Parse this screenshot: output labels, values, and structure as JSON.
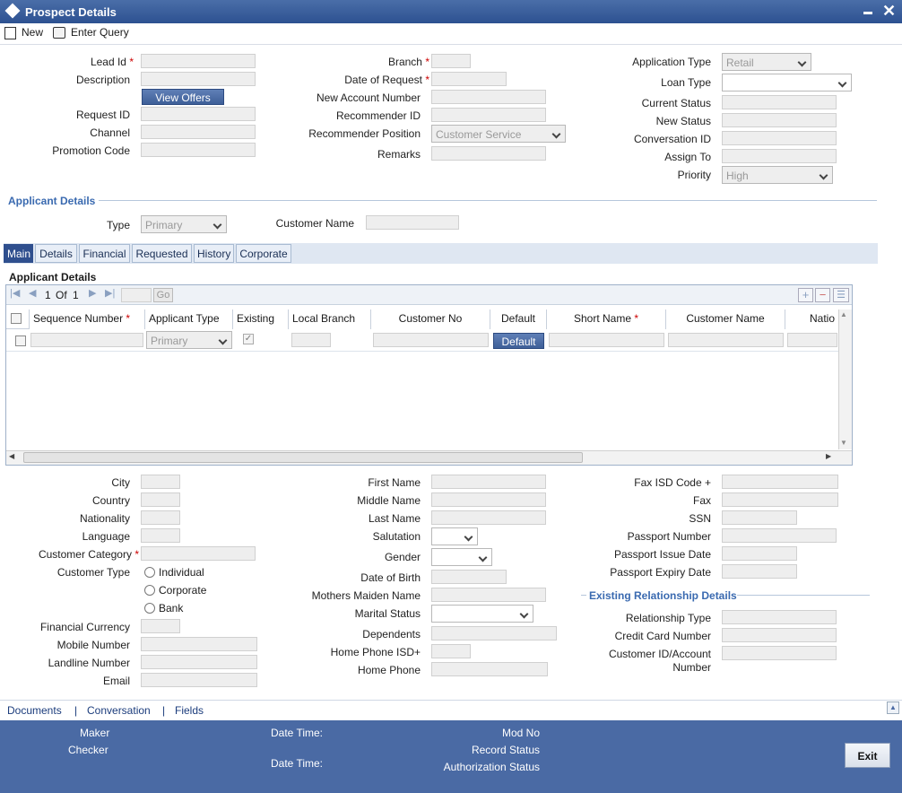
{
  "window": {
    "title": "Prospect Details"
  },
  "toolbar": {
    "new_label": "New",
    "enter_query_label": "Enter Query"
  },
  "header_fields": {
    "lead_id": "Lead Id",
    "description": "Description",
    "view_offers": "View Offers",
    "request_id": "Request ID",
    "channel": "Channel",
    "promotion_code": "Promotion Code",
    "branch": "Branch",
    "date_of_request": "Date of Request",
    "new_account_number": "New Account Number",
    "recommender_id": "Recommender ID",
    "recommender_position": "Recommender Position",
    "recommender_position_value": "Customer Service",
    "remarks": "Remarks",
    "application_type": "Application Type",
    "application_type_value": "Retail",
    "loan_type": "Loan Type",
    "current_status": "Current Status",
    "new_status": "New Status",
    "conversation_id": "Conversation ID",
    "assign_to": "Assign To",
    "priority": "Priority",
    "priority_value": "High"
  },
  "applicant": {
    "section_title": "Applicant Details",
    "type_label": "Type",
    "type_value": "Primary",
    "customer_name_label": "Customer Name"
  },
  "tabs": [
    {
      "label": "Main"
    },
    {
      "label": "Details"
    },
    {
      "label": "Financial"
    },
    {
      "label": "Requested"
    },
    {
      "label": "History"
    },
    {
      "label": "Corporate"
    }
  ],
  "grid": {
    "title": "Applicant Details",
    "page_current": "1",
    "page_of": "Of",
    "page_total": "1",
    "go_label": "Go",
    "columns": [
      "Sequence Number",
      "Applicant Type",
      "Existing",
      "Local Branch",
      "Customer No",
      "Default",
      "Short Name",
      "Customer Name",
      "Natio"
    ],
    "row": {
      "applicant_type": "Primary",
      "default_button": "Default"
    }
  },
  "lower_left": {
    "city": "City",
    "country": "Country",
    "nationality": "Nationality",
    "language": "Language",
    "customer_category": "Customer Category",
    "customer_type": "Customer Type",
    "individual": "Individual",
    "corporate": "Corporate",
    "bank": "Bank",
    "financial_currency": "Financial Currency",
    "mobile_number": "Mobile Number",
    "landline_number": "Landline Number",
    "email": "Email"
  },
  "lower_middle": {
    "first_name": "First Name",
    "middle_name": "Middle Name",
    "last_name": "Last Name",
    "salutation": "Salutation",
    "gender": "Gender",
    "date_of_birth": "Date of Birth",
    "mothers_maiden_name": "Mothers Maiden Name",
    "marital_status": "Marital Status",
    "dependents": "Dependents",
    "home_phone_isd": "Home Phone ISD+",
    "home_phone": "Home Phone"
  },
  "lower_right": {
    "fax_isd": "Fax ISD Code +",
    "fax": "Fax",
    "ssn": "SSN",
    "passport_number": "Passport Number",
    "passport_issue_date": "Passport Issue Date",
    "passport_expiry_date": "Passport Expiry Date",
    "existing_relationship_title": "Existing Relationship Details",
    "relationship_type": "Relationship Type",
    "credit_card_number": "Credit Card Number",
    "customer_id_account_1": "Customer ID/Account",
    "customer_id_account_2": "Number"
  },
  "footer_links": {
    "documents": "Documents",
    "sep1": "|",
    "conversation": "Conversation",
    "sep2": "|",
    "fields": "Fields"
  },
  "status": {
    "maker": "Maker",
    "checker": "Checker",
    "date_time_1": "Date Time:",
    "date_time_2": "Date Time:",
    "mod_no": "Mod No",
    "record_status": "Record Status",
    "authorization_status": "Authorization Status",
    "exit": "Exit"
  },
  "colors": {
    "title_bar": "#2d5191",
    "section_text": "#3a6ab0",
    "status_bar": "#4a6aa4"
  }
}
